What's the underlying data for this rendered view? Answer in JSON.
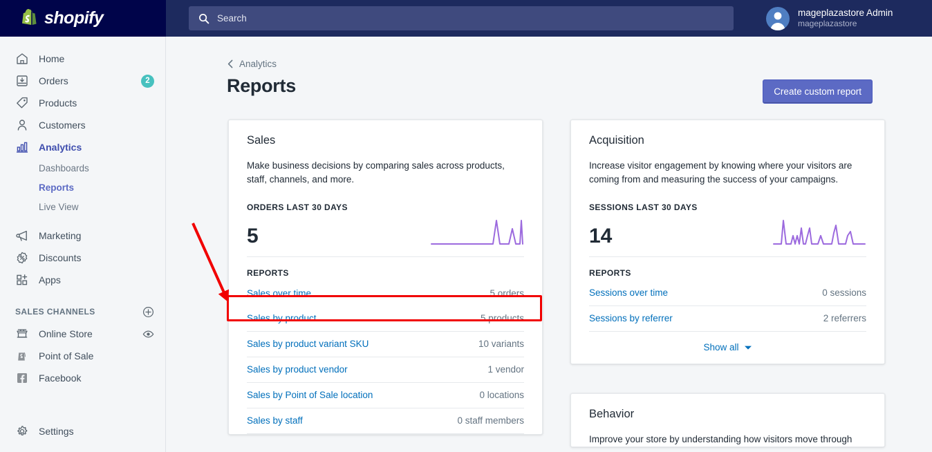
{
  "topbar": {
    "logo_text": "shopify",
    "logo_icon": "shopify-bag-icon",
    "search": {
      "placeholder": "Search",
      "value": "",
      "icon": "search-icon"
    },
    "user": {
      "name": "mageplazastore Admin",
      "store": "mageplazastore",
      "avatar_icon": "user-avatar-icon"
    }
  },
  "sidebar": {
    "items": [
      {
        "label": "Home",
        "icon": "home-icon",
        "badge": ""
      },
      {
        "label": "Orders",
        "icon": "orders-inbox-icon",
        "badge": "2"
      },
      {
        "label": "Products",
        "icon": "tag-icon",
        "badge": ""
      },
      {
        "label": "Customers",
        "icon": "person-icon",
        "badge": ""
      },
      {
        "label": "Analytics",
        "icon": "bar-chart-icon",
        "badge": ""
      }
    ],
    "analytics_subitems": [
      {
        "label": "Dashboards",
        "current": false
      },
      {
        "label": "Reports",
        "current": true
      },
      {
        "label": "Live View",
        "current": false
      }
    ],
    "items_after": [
      {
        "label": "Marketing",
        "icon": "megaphone-icon"
      },
      {
        "label": "Discounts",
        "icon": "discount-percent-icon"
      },
      {
        "label": "Apps",
        "icon": "apps-grid-plus-icon"
      }
    ],
    "sales_channels": {
      "title": "SALES CHANNELS",
      "add_icon": "plus-circle-icon",
      "items": [
        {
          "label": "Online Store",
          "icon": "storefront-icon",
          "trailing_icon": "eye-icon"
        },
        {
          "label": "Point of Sale",
          "icon": "pos-bag-icon",
          "trailing_icon": ""
        },
        {
          "label": "Facebook",
          "icon": "facebook-icon",
          "trailing_icon": ""
        }
      ]
    },
    "settings": {
      "label": "Settings",
      "icon": "gear-icon"
    }
  },
  "page": {
    "breadcrumb": {
      "label": "Analytics",
      "icon": "chevron-left-icon"
    },
    "title": "Reports",
    "primary_action": "Create custom report"
  },
  "cards": {
    "sales": {
      "title": "Sales",
      "description": "Make business decisions by comparing sales across products, staff, channels, and more.",
      "metric_label": "ORDERS LAST 30 DAYS",
      "metric_value": "5",
      "reports_label": "REPORTS",
      "reports": [
        {
          "name": "Sales over time",
          "count": "5 orders",
          "highlighted": true
        },
        {
          "name": "Sales by product",
          "count": "5 products",
          "highlighted": false
        },
        {
          "name": "Sales by product variant SKU",
          "count": "10 variants",
          "highlighted": false
        },
        {
          "name": "Sales by product vendor",
          "count": "1 vendor",
          "highlighted": false
        },
        {
          "name": "Sales by Point of Sale location",
          "count": "0 locations",
          "highlighted": false
        },
        {
          "name": "Sales by staff",
          "count": "0 staff members",
          "highlighted": false
        }
      ]
    },
    "acquisition": {
      "title": "Acquisition",
      "description": "Increase visitor engagement by knowing where your visitors are coming from and measuring the success of your campaigns.",
      "metric_label": "SESSIONS LAST 30 DAYS",
      "metric_value": "14",
      "reports_label": "REPORTS",
      "reports": [
        {
          "name": "Sessions over time",
          "count": "0 sessions"
        },
        {
          "name": "Sessions by referrer",
          "count": "2 referrers"
        }
      ],
      "show_all": {
        "label": "Show all",
        "icon": "chevron-down-icon"
      }
    },
    "behavior": {
      "title": "Behavior",
      "description": "Improve your store by understanding how visitors move through"
    }
  },
  "annotation": {
    "highlight_color": "#f10000",
    "arrow_color": "#f10000",
    "arrow_target": "Sales over time"
  },
  "chart_data": [
    {
      "type": "line",
      "title": "ORDERS LAST 30 DAYS",
      "series": [
        {
          "name": "Orders",
          "values": [
            0,
            0,
            0,
            0,
            0,
            0,
            0,
            0,
            0,
            0,
            0,
            0,
            0,
            0,
            0,
            0,
            0,
            0,
            0,
            0,
            0,
            2,
            0,
            0,
            1,
            0,
            1,
            0,
            2,
            0
          ]
        }
      ],
      "x": [
        1,
        2,
        3,
        4,
        5,
        6,
        7,
        8,
        9,
        10,
        11,
        12,
        13,
        14,
        15,
        16,
        17,
        18,
        19,
        20,
        21,
        22,
        23,
        24,
        25,
        26,
        27,
        28,
        29,
        30
      ],
      "xlabel": "",
      "ylabel": "",
      "ylim": [
        0,
        2
      ],
      "grid": false,
      "legend": "none",
      "color": "#9c6ade"
    },
    {
      "type": "line",
      "title": "SESSIONS LAST 30 DAYS",
      "series": [
        {
          "name": "Sessions",
          "values": [
            0,
            0,
            3,
            0,
            0,
            1,
            0,
            1,
            0,
            2,
            0,
            1,
            2,
            0,
            0,
            1,
            0,
            0,
            0,
            0,
            1,
            2,
            0,
            1,
            0,
            1,
            0,
            0,
            0,
            0
          ]
        }
      ],
      "x": [
        1,
        2,
        3,
        4,
        5,
        6,
        7,
        8,
        9,
        10,
        11,
        12,
        13,
        14,
        15,
        16,
        17,
        18,
        19,
        20,
        21,
        22,
        23,
        24,
        25,
        26,
        27,
        28,
        29,
        30
      ],
      "xlabel": "",
      "ylabel": "",
      "ylim": [
        0,
        3
      ],
      "grid": false,
      "legend": "none",
      "color": "#9c6ade"
    }
  ]
}
